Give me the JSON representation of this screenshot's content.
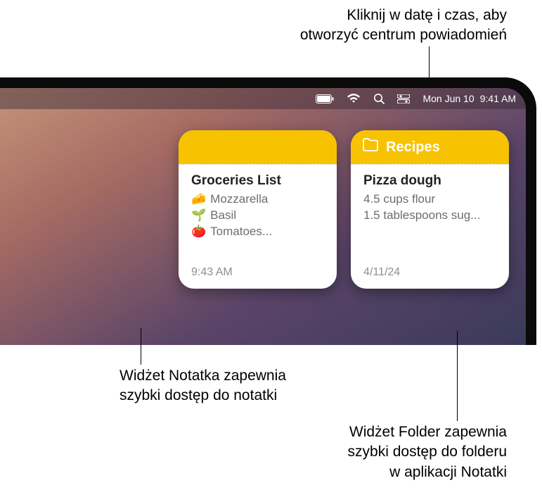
{
  "callouts": {
    "top": "Kliknij w datę i czas, aby\notworzyć centrum powiadomień",
    "bottom_left": "Widżet Notatka zapewnia\nszybki dostęp do notatki",
    "bottom_right": "Widżet Folder zapewnia\nszybki dostęp do folderu\nw aplikacji Notatki"
  },
  "menubar": {
    "date": "Mon Jun 10",
    "time": "9:41 AM"
  },
  "widgets": {
    "note": {
      "title": "Groceries List",
      "lines": [
        {
          "emoji": "🧀",
          "text": "Mozzarella"
        },
        {
          "emoji": "🌱",
          "text": "Basil"
        },
        {
          "emoji": "🍅",
          "text": "Tomatoes..."
        }
      ],
      "footer": "9:43 AM"
    },
    "folder": {
      "header": "Recipes",
      "title": "Pizza dough",
      "lines": [
        "4.5 cups flour",
        "1.5 tablespoons sug..."
      ],
      "footer": "4/11/24"
    }
  }
}
